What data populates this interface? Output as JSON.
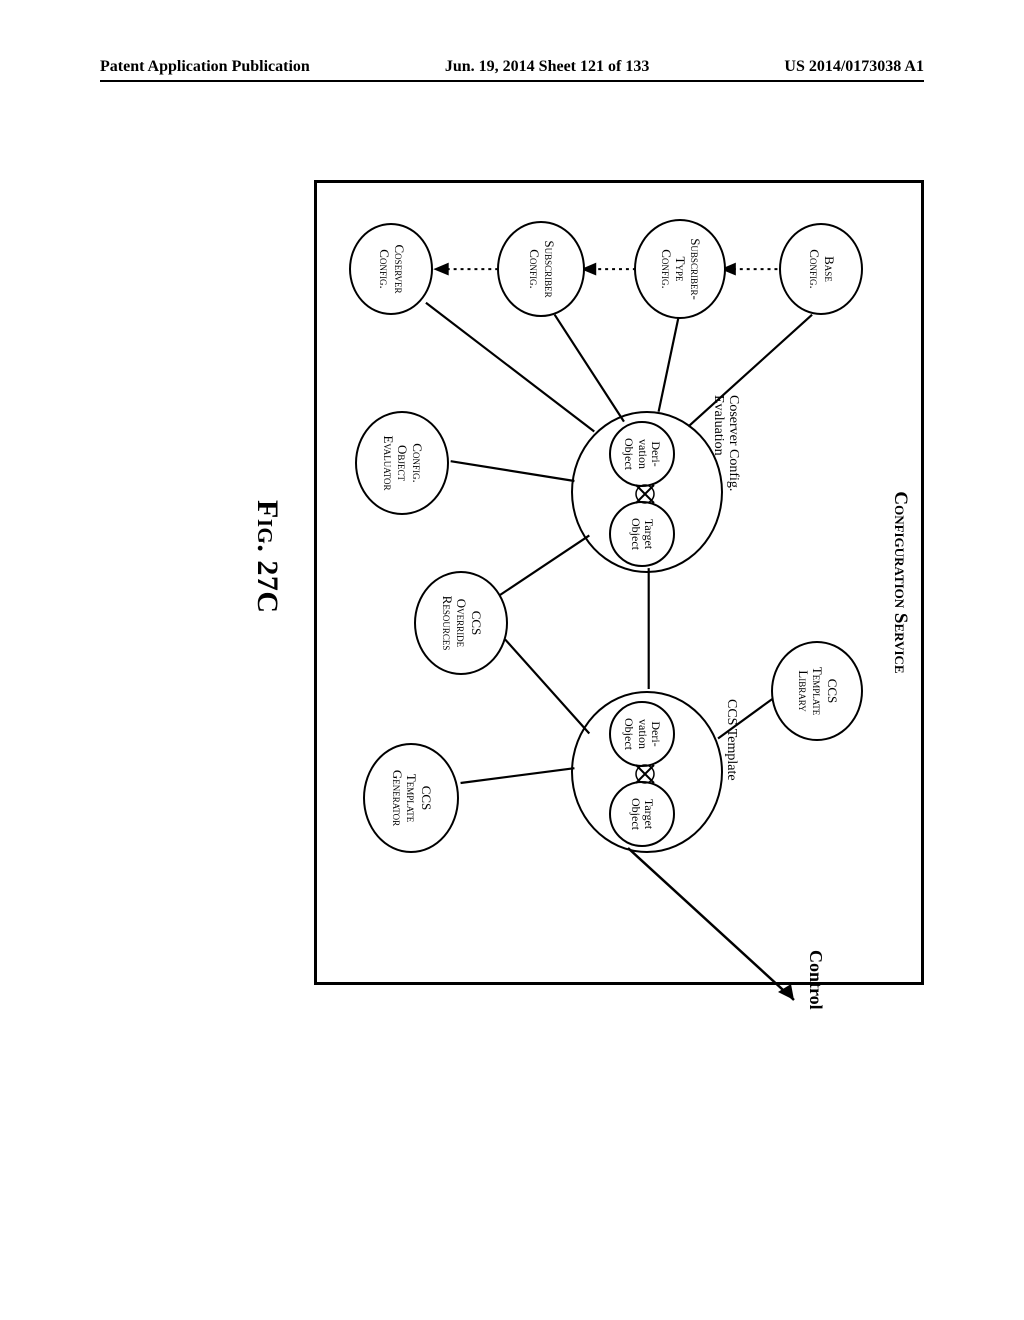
{
  "header": {
    "left": "Patent Application Publication",
    "center": "Jun. 19, 2014  Sheet 121 of 133",
    "right": "US 2014/0173038 A1"
  },
  "figure": {
    "service_title": "Configuration Service",
    "nodes": {
      "base_config": "Base\nConfig.",
      "subscriber_type_config": "Subscriber-\nType\nConfig.",
      "subscriber_config": "Subscriber\nConfig.",
      "coserver_config": "Coserver\nConfig.",
      "config_obj_eval": "Config.\nObject\nEvaluator",
      "ccs_override": "CCS\nOverride\nResources",
      "ccs_template_gen": "CCS\nTemplate\nGenerator",
      "ccs_tmpl_lib": "CCS\nTemplate\nLibrary"
    },
    "groups": {
      "coserver_eval": {
        "title": "Coserver Config.\nEvaluation",
        "deriv": "Deri-\nvation\nObject",
        "target": "Target\nObject"
      },
      "ccs_template": {
        "title": "CCS Template",
        "deriv": "Deri-\nvation\nObject",
        "target": "Target\nObject"
      }
    },
    "control_label": "Control",
    "figure_label": "Fig. 27C"
  },
  "chart_data": {
    "type": "diagram",
    "title": "Configuration Service",
    "node_groups": [
      {
        "name": "Coserver Config. Evaluation",
        "children": [
          "Derivation Object",
          "Target Object"
        ]
      },
      {
        "name": "CCS Template",
        "children": [
          "Derivation Object",
          "Target Object"
        ]
      }
    ],
    "nodes": [
      "Base Config.",
      "Subscriber-Type Config.",
      "Subscriber Config.",
      "Coserver Config.",
      "Config. Object Evaluator",
      "CCS Override Resources",
      "CCS Template Generator",
      "CCS Template Library"
    ],
    "edges": [
      [
        "Base Config.",
        "Coserver Config. Evaluation"
      ],
      [
        "Subscriber-Type Config.",
        "Coserver Config. Evaluation"
      ],
      [
        "Subscriber Config.",
        "Coserver Config. Evaluation"
      ],
      [
        "Coserver Config.",
        "Coserver Config. Evaluation"
      ],
      [
        "Config. Object Evaluator",
        "Coserver Config. Evaluation"
      ],
      [
        "CCS Override Resources",
        "Coserver Config. Evaluation"
      ],
      [
        "Coserver Config. Evaluation",
        "CCS Template"
      ],
      [
        "CCS Override Resources",
        "CCS Template"
      ],
      [
        "CCS Template Generator",
        "CCS Template"
      ],
      [
        "CCS Template Library",
        "CCS Template"
      ],
      [
        "CCS Template",
        "Control (output)"
      ]
    ],
    "ordered_chain_arrows": [
      "Base Config.",
      "Subscriber-Type Config.",
      "Subscriber Config.",
      "Coserver Config."
    ]
  }
}
